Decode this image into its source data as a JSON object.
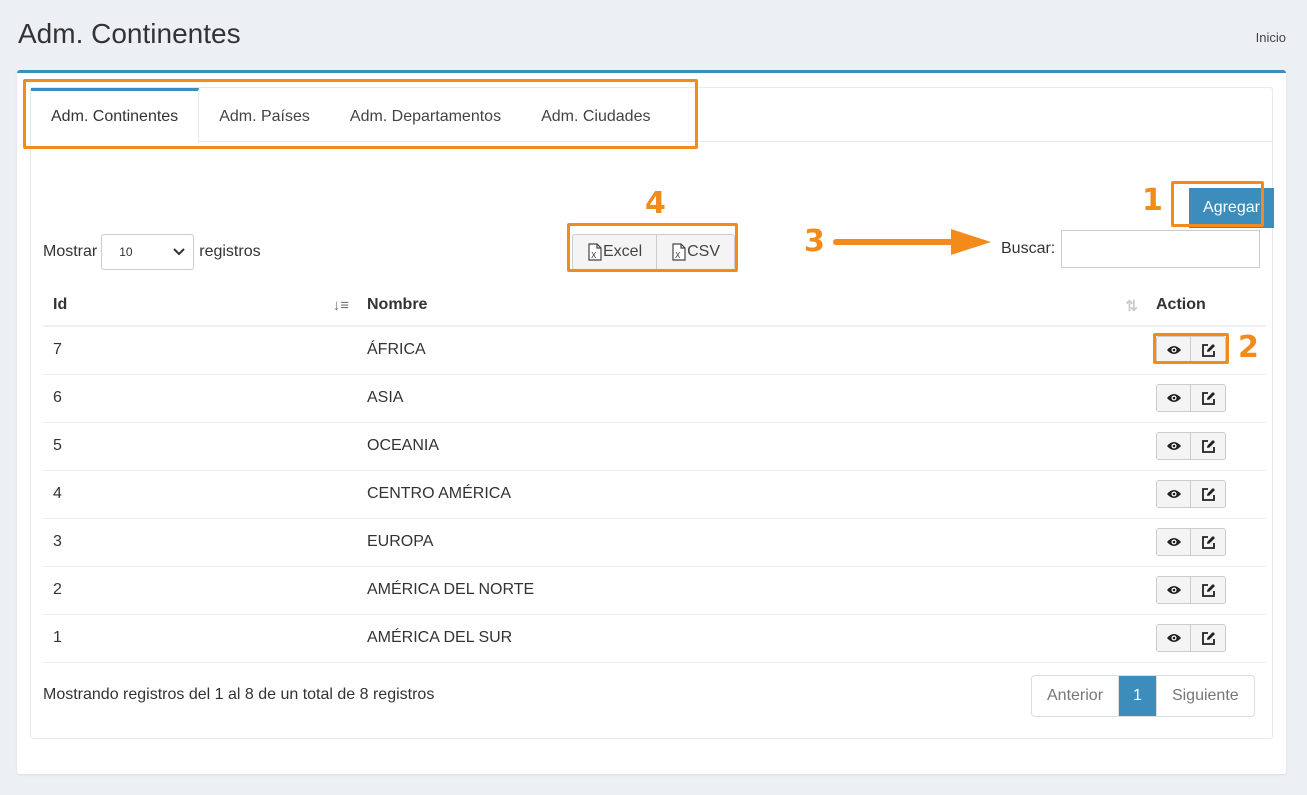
{
  "header": {
    "title": "Adm. Continentes",
    "breadcrumb": "Inicio"
  },
  "tabs": [
    {
      "label": "Adm. Continentes"
    },
    {
      "label": "Adm. Países"
    },
    {
      "label": "Adm. Departamentos"
    },
    {
      "label": "Adm. Ciudades"
    }
  ],
  "add_button": "Agregar",
  "length": {
    "prefix": "Mostrar",
    "value": "10",
    "suffix": "registros"
  },
  "export": {
    "excel": "Excel",
    "csv": "CSV"
  },
  "search": {
    "label": "Buscar:",
    "value": ""
  },
  "table": {
    "headers": {
      "id": "Id",
      "name": "Nombre",
      "action": "Action"
    },
    "rows": [
      {
        "id": "7",
        "name": "ÁFRICA"
      },
      {
        "id": "6",
        "name": "ASIA"
      },
      {
        "id": "5",
        "name": "OCEANIA"
      },
      {
        "id": "4",
        "name": "CENTRO AMÉRICA"
      },
      {
        "id": "3",
        "name": "EUROPA"
      },
      {
        "id": "2",
        "name": "AMÉRICA DEL NORTE"
      },
      {
        "id": "1",
        "name": "AMÉRICA DEL SUR"
      }
    ]
  },
  "info": "Mostrando registros del 1 al 8 de un total de 8 registros",
  "pagination": {
    "prev": "Anterior",
    "current": "1",
    "next": "Siguiente"
  },
  "annotations": {
    "n1": "1",
    "n2": "2",
    "n3": "3",
    "n4": "4"
  },
  "colors": {
    "accent": "#3c8dbc",
    "highlight": "#f28a1c"
  }
}
